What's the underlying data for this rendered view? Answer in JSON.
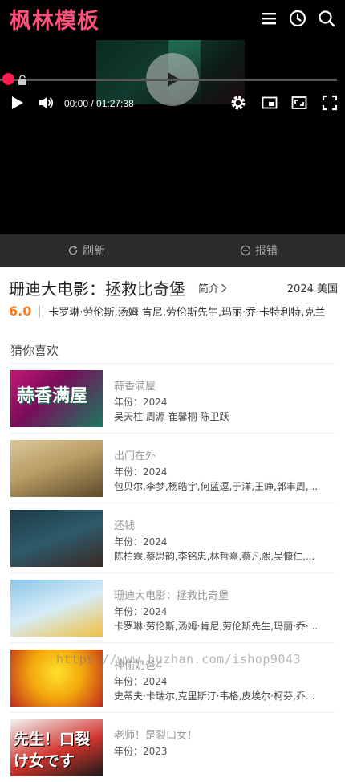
{
  "header": {
    "logo": "枫林模板",
    "icons": [
      "menu-icon",
      "history-icon",
      "search-icon"
    ]
  },
  "player": {
    "time": "00:00 / 01:27:38",
    "progress": 0,
    "icons": [
      "play-icon",
      "volume-icon",
      "settings-icon",
      "picture-in-picture-icon",
      "widescreen-icon",
      "fullscreen-icon"
    ]
  },
  "actions": {
    "refresh": "刷新",
    "report": "报错"
  },
  "movie": {
    "title": "珊迪大电影：拯救比奇堡",
    "intro": "简介",
    "year_country": "2024 美国",
    "score": "6.0",
    "cast": "卡罗琳·劳伦斯,汤姆·肯尼,劳伦斯先生,玛丽·乔·卡特利特,克兰"
  },
  "recommendations": {
    "heading": "猜你喜欢",
    "items": [
      {
        "title": "蒜香满屋",
        "year": "年份：2024",
        "actors": "吴天柱 周源 崔馨桐 陈卫跃",
        "thumb_text": "蒜香满屋"
      },
      {
        "title": "出门在外",
        "year": "年份：2024",
        "actors": "包贝尔,李梦,杨皓宇,何蓝逗,于洋,王峥,郭丰周,...",
        "thumb_text": ""
      },
      {
        "title": "还钱",
        "year": "年份：2024",
        "actors": "陈柏霖,蔡思韵,李铭忠,林哲熹,蔡凡熙,吴慷仁,...",
        "thumb_text": ""
      },
      {
        "title": "珊迪大电影：拯救比奇堡",
        "year": "年份：2024",
        "actors": "卡罗琳·劳伦斯,汤姆·肯尼,劳伦斯先生,玛丽·乔·...",
        "thumb_text": ""
      },
      {
        "title": "神偷奶爸4",
        "year": "年份：2024",
        "actors": "史蒂夫·卡瑞尔,克里斯汀·韦格,皮埃尔·柯芬,乔...",
        "thumb_text": ""
      },
      {
        "title": "老师！是裂口女！",
        "year": "年份：2023",
        "actors": "",
        "thumb_text": "先生！口裂け女です"
      }
    ]
  },
  "watermark": "https://www.huzhan.com/ishop9043",
  "colors": {
    "logo": "#ff4f7b",
    "progress_dot": "#ff1a4f",
    "score": "#ff7a1a",
    "action_bar": "#2b2b2b"
  }
}
